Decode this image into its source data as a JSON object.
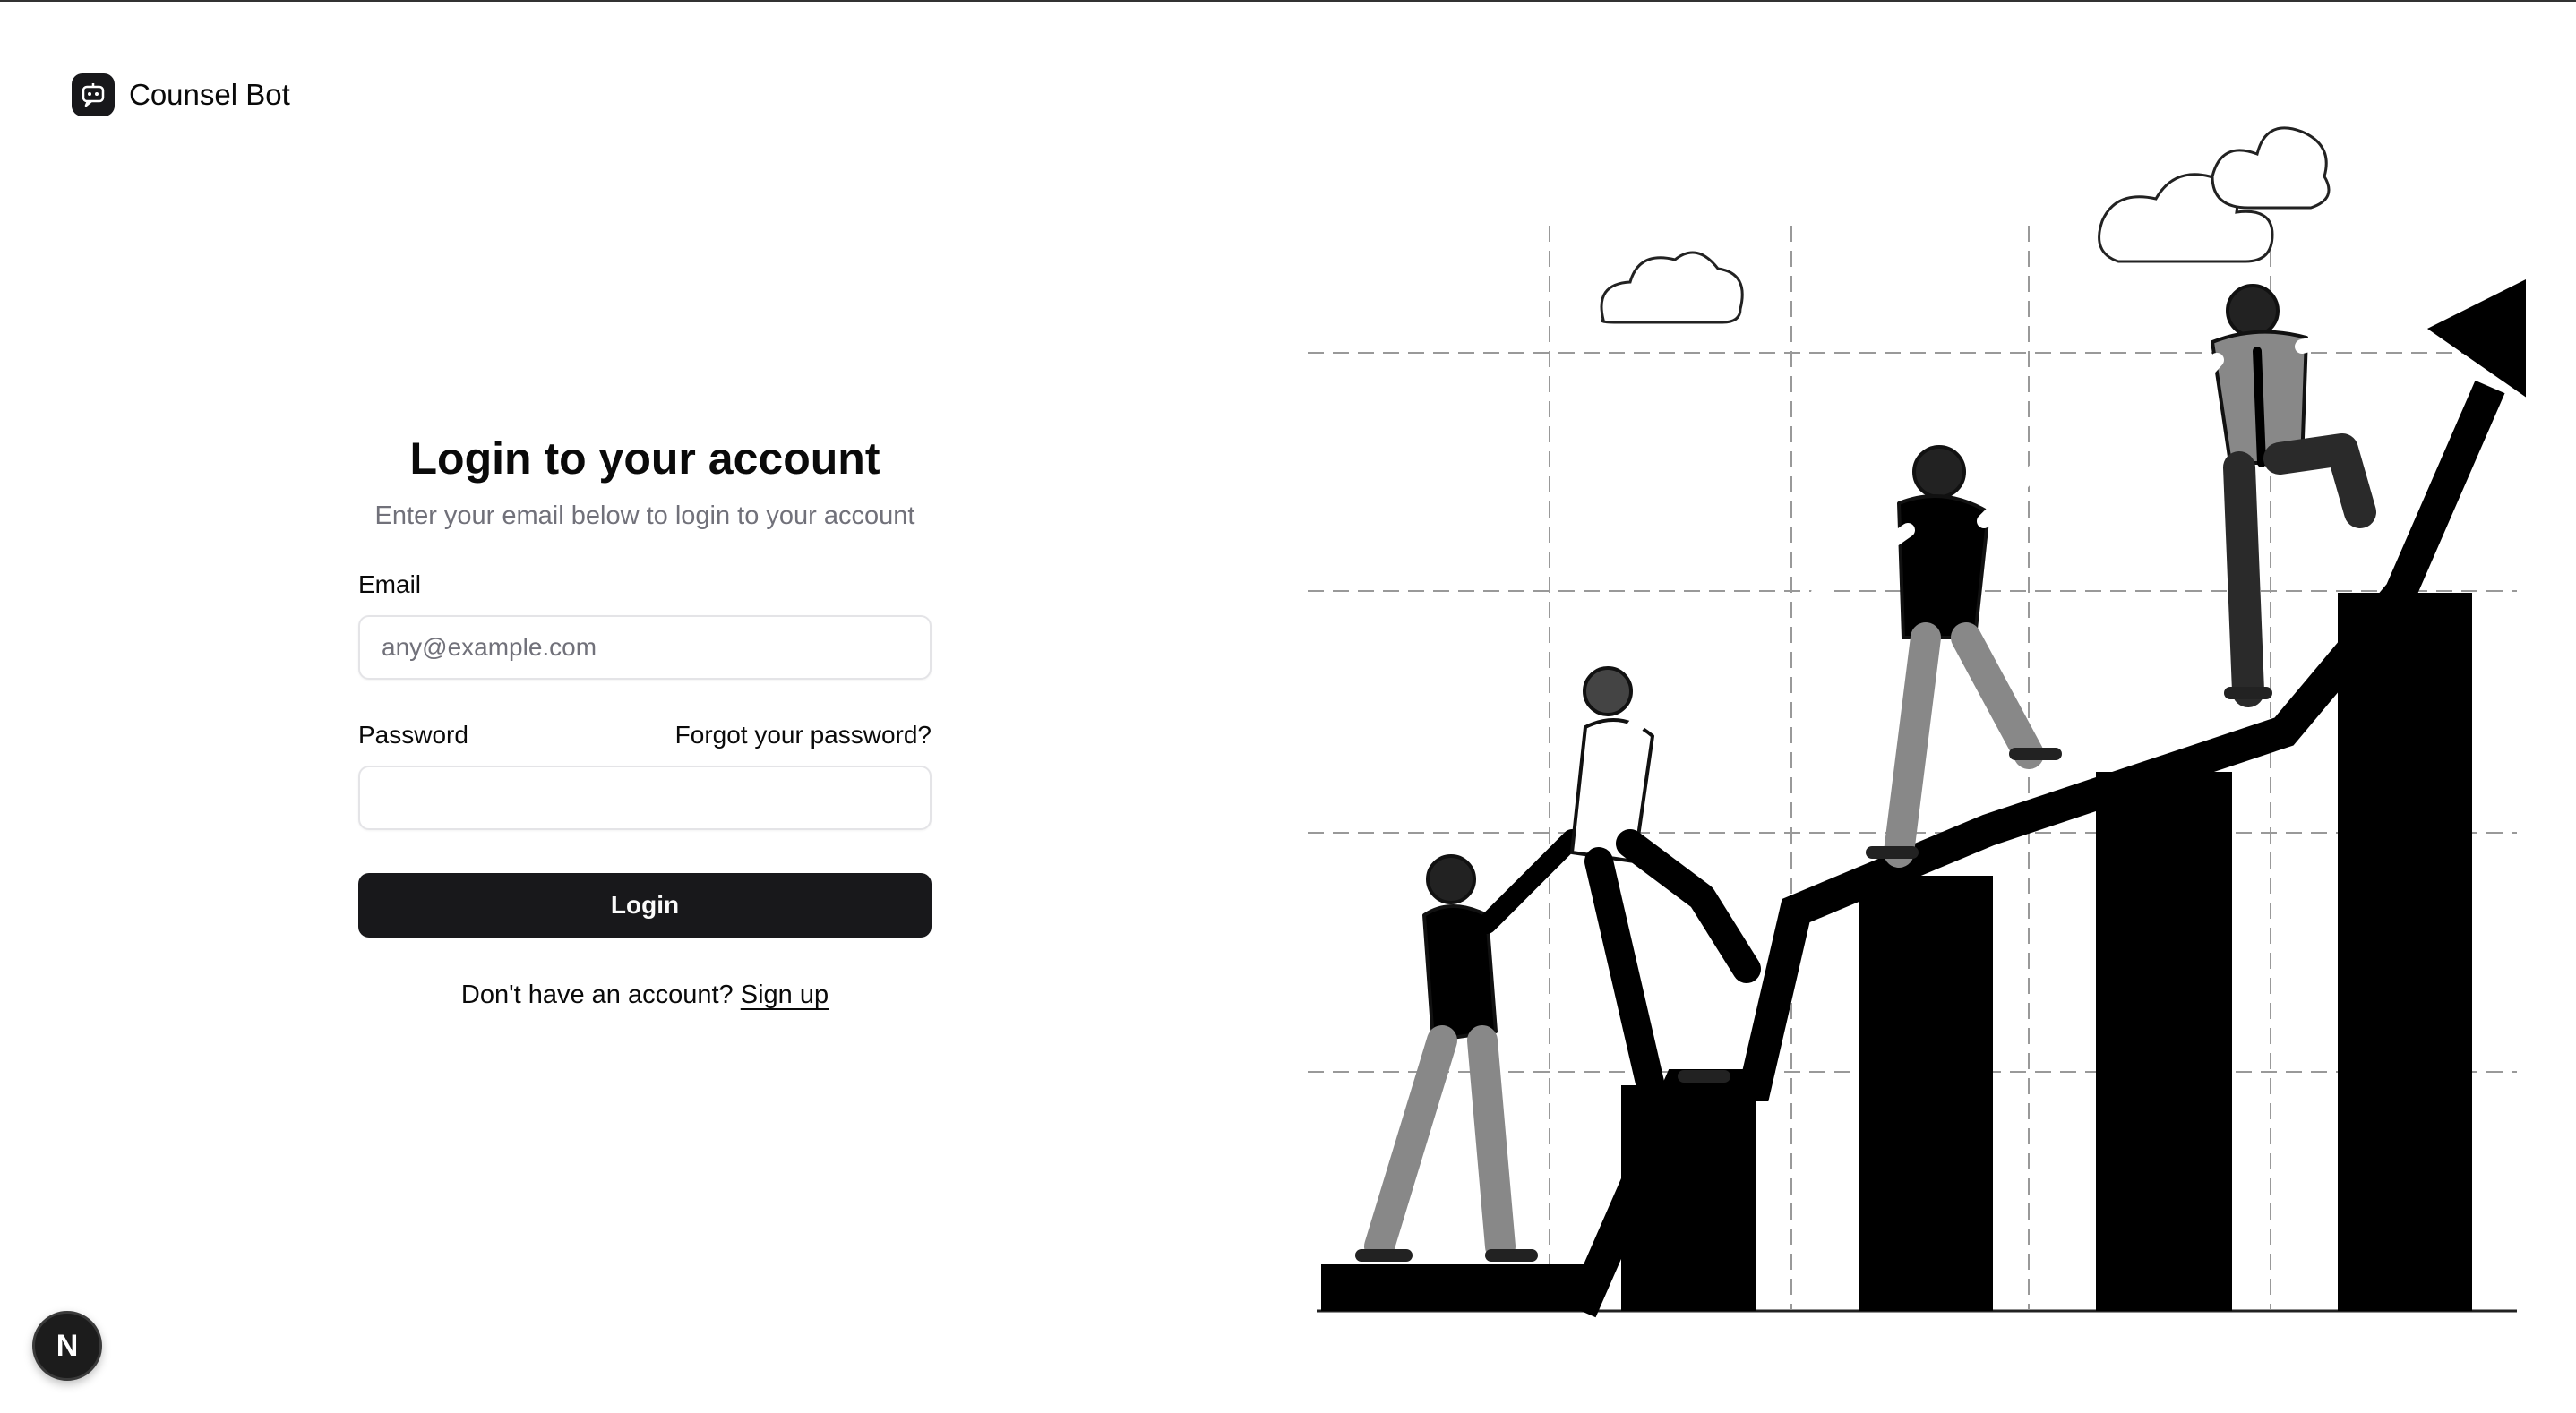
{
  "brand": {
    "name": "Counsel Bot",
    "icon": "chat-bot-icon"
  },
  "login_form": {
    "title": "Login to your account",
    "subtitle": "Enter your email below to login to your account",
    "email_label": "Email",
    "email_placeholder": "any@example.com",
    "email_value": "",
    "password_label": "Password",
    "password_value": "",
    "forgot_link": "Forgot your password?",
    "submit_label": "Login",
    "signup_prompt": "Don't have an account?",
    "signup_link": "Sign up"
  },
  "illustration": {
    "description_icon": "team-climbing-growth-chart-icon"
  },
  "dev_badge": {
    "letter": "N",
    "icon": "nextjs-dev-icon"
  },
  "colors": {
    "primary": "#18181b",
    "muted_text": "#71717a",
    "border": "#e4e4e7",
    "background": "#ffffff"
  }
}
